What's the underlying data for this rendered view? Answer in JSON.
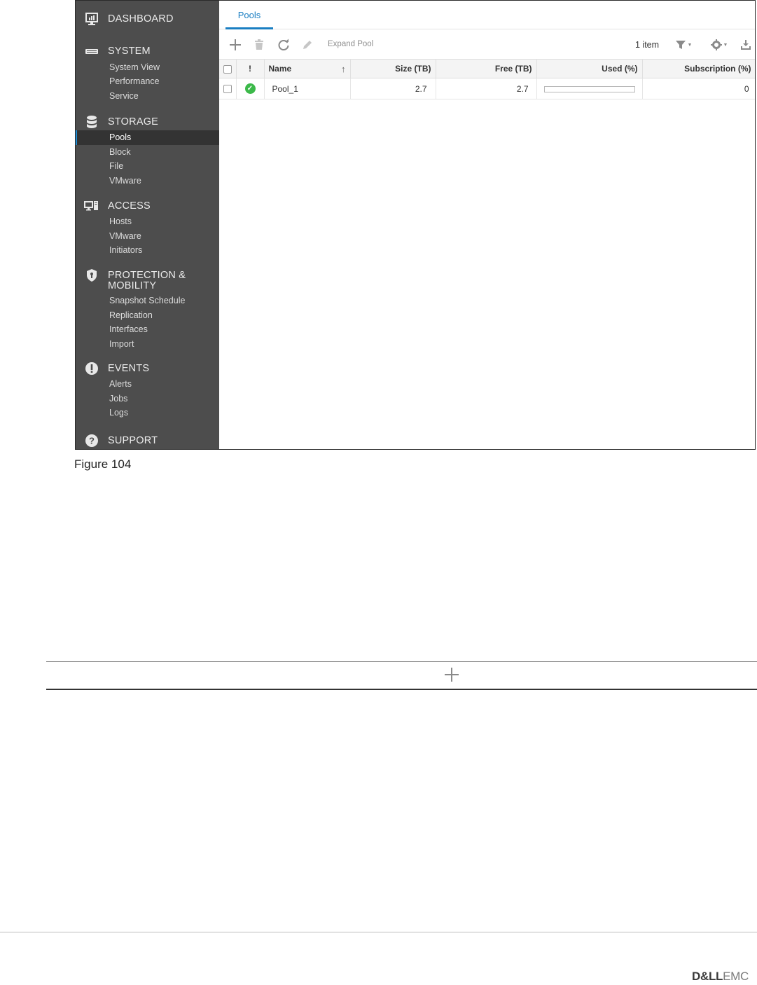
{
  "sidebar": {
    "sections": [
      {
        "title": "DASHBOARD",
        "icon": "dashboard-icon",
        "items": []
      },
      {
        "title": "SYSTEM",
        "icon": "system-icon",
        "items": [
          "System View",
          "Performance",
          "Service"
        ]
      },
      {
        "title": "STORAGE",
        "icon": "storage-icon",
        "items": [
          "Pools",
          "Block",
          "File",
          "VMware"
        ]
      },
      {
        "title": "ACCESS",
        "icon": "access-icon",
        "items": [
          "Hosts",
          "VMware",
          "Initiators"
        ]
      },
      {
        "title": "PROTECTION &",
        "title2": "MOBILITY",
        "icon": "shield-icon",
        "items": [
          "Snapshot Schedule",
          "Replication",
          "Interfaces",
          "Import"
        ]
      },
      {
        "title": "EVENTS",
        "icon": "events-icon",
        "items": [
          "Alerts",
          "Jobs",
          "Logs"
        ]
      },
      {
        "title": "SUPPORT",
        "icon": "help-icon",
        "items": []
      }
    ],
    "active_item": "Pools"
  },
  "tabs": [
    "Pools"
  ],
  "toolbar": {
    "expand_label": "Expand Pool",
    "item_count": "1 item",
    "icons": [
      "add-icon",
      "delete-icon",
      "refresh-icon",
      "edit-icon",
      "filter-icon",
      "settings-icon",
      "export-icon"
    ]
  },
  "table": {
    "columns": [
      "",
      "!",
      "Name",
      "Size (TB)",
      "Free (TB)",
      "Used (%)",
      "Subscription (%)"
    ],
    "rows": [
      {
        "status": "ok",
        "name": "Pool_1",
        "size": "2.7",
        "free": "2.7",
        "used": 0,
        "subscription": "0"
      }
    ]
  },
  "caption": "Figure 104",
  "logo": {
    "bold": "D&LL",
    "light": "EMC"
  },
  "colors": {
    "sidebar": "#4d4d4d",
    "accent": "#1a7ec2",
    "ok": "#3cb94a"
  }
}
